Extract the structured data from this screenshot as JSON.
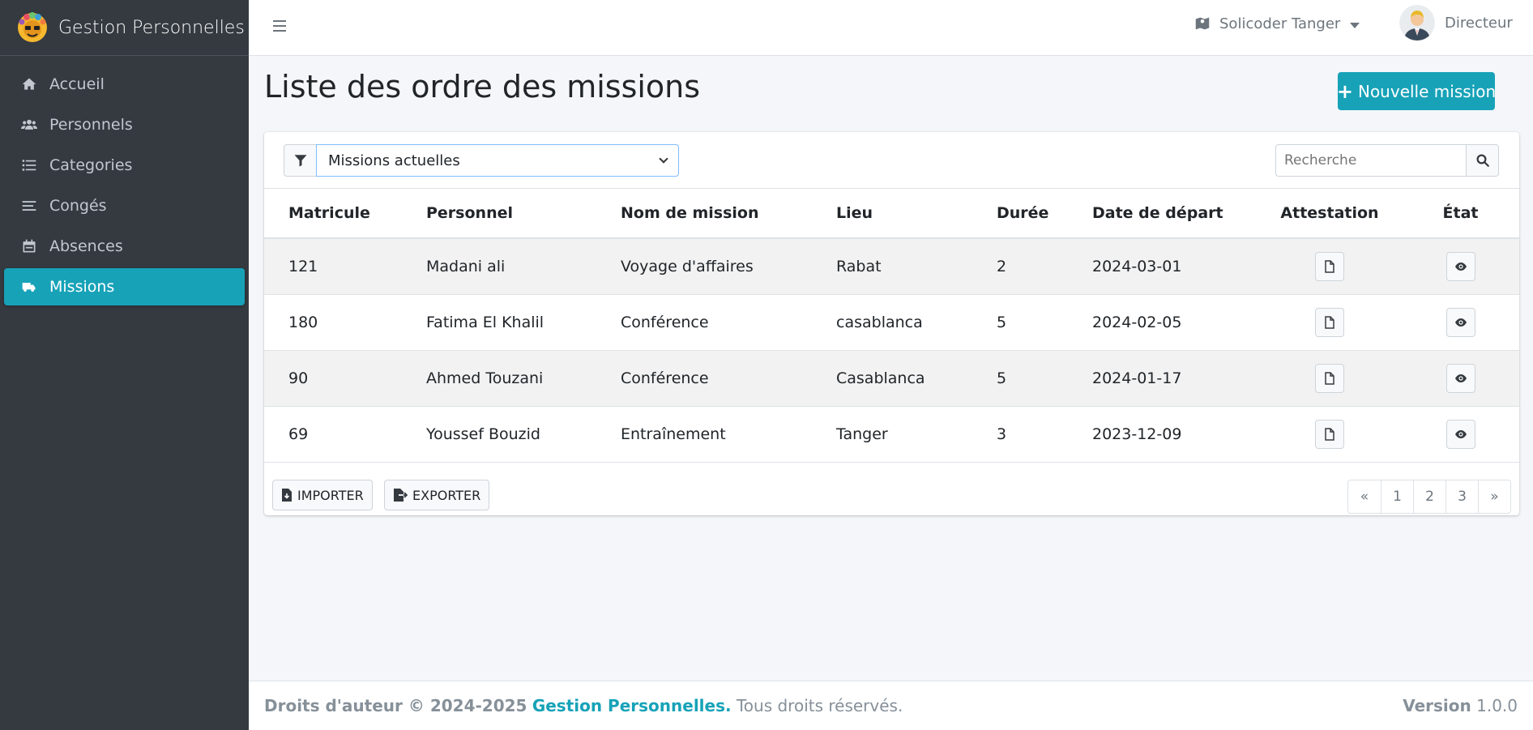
{
  "brand": {
    "title": "Gestion Personnelles"
  },
  "sidebar": {
    "items": [
      {
        "label": "Accueil",
        "icon": "home-icon"
      },
      {
        "label": "Personnels",
        "icon": "users-icon"
      },
      {
        "label": "Categories",
        "icon": "list-icon"
      },
      {
        "label": "Congés",
        "icon": "bars-icon"
      },
      {
        "label": "Absences",
        "icon": "calendar-icon"
      },
      {
        "label": "Missions",
        "icon": "truck-icon",
        "active": true
      }
    ]
  },
  "topbar": {
    "organization": "Solicoder Tanger",
    "user_role": "Directeur"
  },
  "page": {
    "title": "Liste des ordre des missions",
    "new_button": "Nouvelle mission"
  },
  "filter": {
    "selected": "Missions actuelles"
  },
  "search": {
    "placeholder": "Recherche"
  },
  "table": {
    "headers": [
      "Matricule",
      "Personnel",
      "Nom de mission",
      "Lieu",
      "Durée",
      "Date de départ",
      "Attestation",
      "État"
    ],
    "rows": [
      [
        "121",
        "Madani ali",
        "Voyage d'affaires",
        "Rabat",
        "2",
        "2024-03-01"
      ],
      [
        "180",
        "Fatima El Khalil",
        "Conférence",
        "casablanca",
        "5",
        "2024-02-05"
      ],
      [
        "90",
        "Ahmed Touzani",
        "Conférence",
        "Casablanca",
        "5",
        "2024-01-17"
      ],
      [
        "69",
        "Youssef Bouzid",
        "Entraînement",
        "Tanger",
        "3",
        "2023-12-09"
      ]
    ]
  },
  "actions": {
    "import": "IMPORTER",
    "export": "EXPORTER"
  },
  "pagination": [
    "«",
    "1",
    "2",
    "3",
    "»"
  ],
  "footer": {
    "copyright": "Droits d'auteur © 2024-2025",
    "brand": "Gestion Personnelles.",
    "rights": "Tous droits réservés.",
    "version_label": "Version",
    "version": "1.0.0"
  },
  "colors": {
    "accent": "#17a2b8",
    "sidebar": "#343a40"
  }
}
